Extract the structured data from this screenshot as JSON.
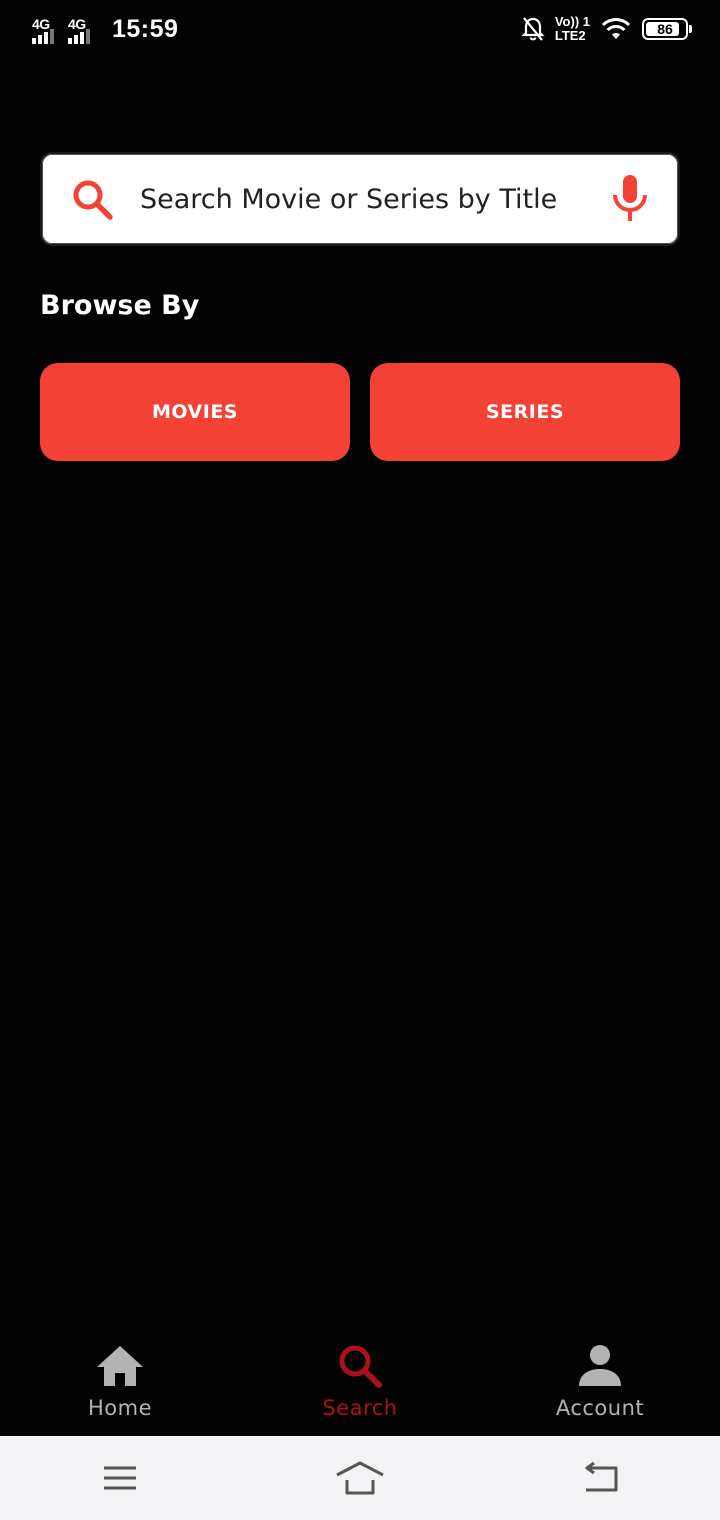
{
  "status_bar": {
    "network1": "4G",
    "network2": "4G",
    "time": "15:59",
    "volte_top": "Vo)) 1",
    "volte_bottom": "LTE2",
    "battery_level": "86",
    "battery_fraction": 0.86,
    "icons": [
      "signal-bars-icon",
      "mute-bell-icon",
      "wifi-icon",
      "battery-icon"
    ]
  },
  "search": {
    "placeholder": "Search Movie or Series by Title",
    "value": "",
    "icon": "search-icon",
    "voice_icon": "microphone-icon"
  },
  "browse": {
    "title": "Browse By",
    "buttons": [
      {
        "label": "MOVIES"
      },
      {
        "label": "SERIES"
      }
    ]
  },
  "bottom_nav": {
    "items": [
      {
        "label": "Home",
        "icon": "home-icon"
      },
      {
        "label": "Search",
        "icon": "search-icon",
        "active": true
      },
      {
        "label": "Account",
        "icon": "account-icon"
      }
    ]
  },
  "system_nav": {
    "icons": [
      "menu-icon",
      "home-outline-icon",
      "back-icon"
    ]
  },
  "colors": {
    "accent": "#f44336",
    "active_nav": "#a9121b",
    "background": "#030203",
    "inactive_nav": "#b3b3b3"
  }
}
